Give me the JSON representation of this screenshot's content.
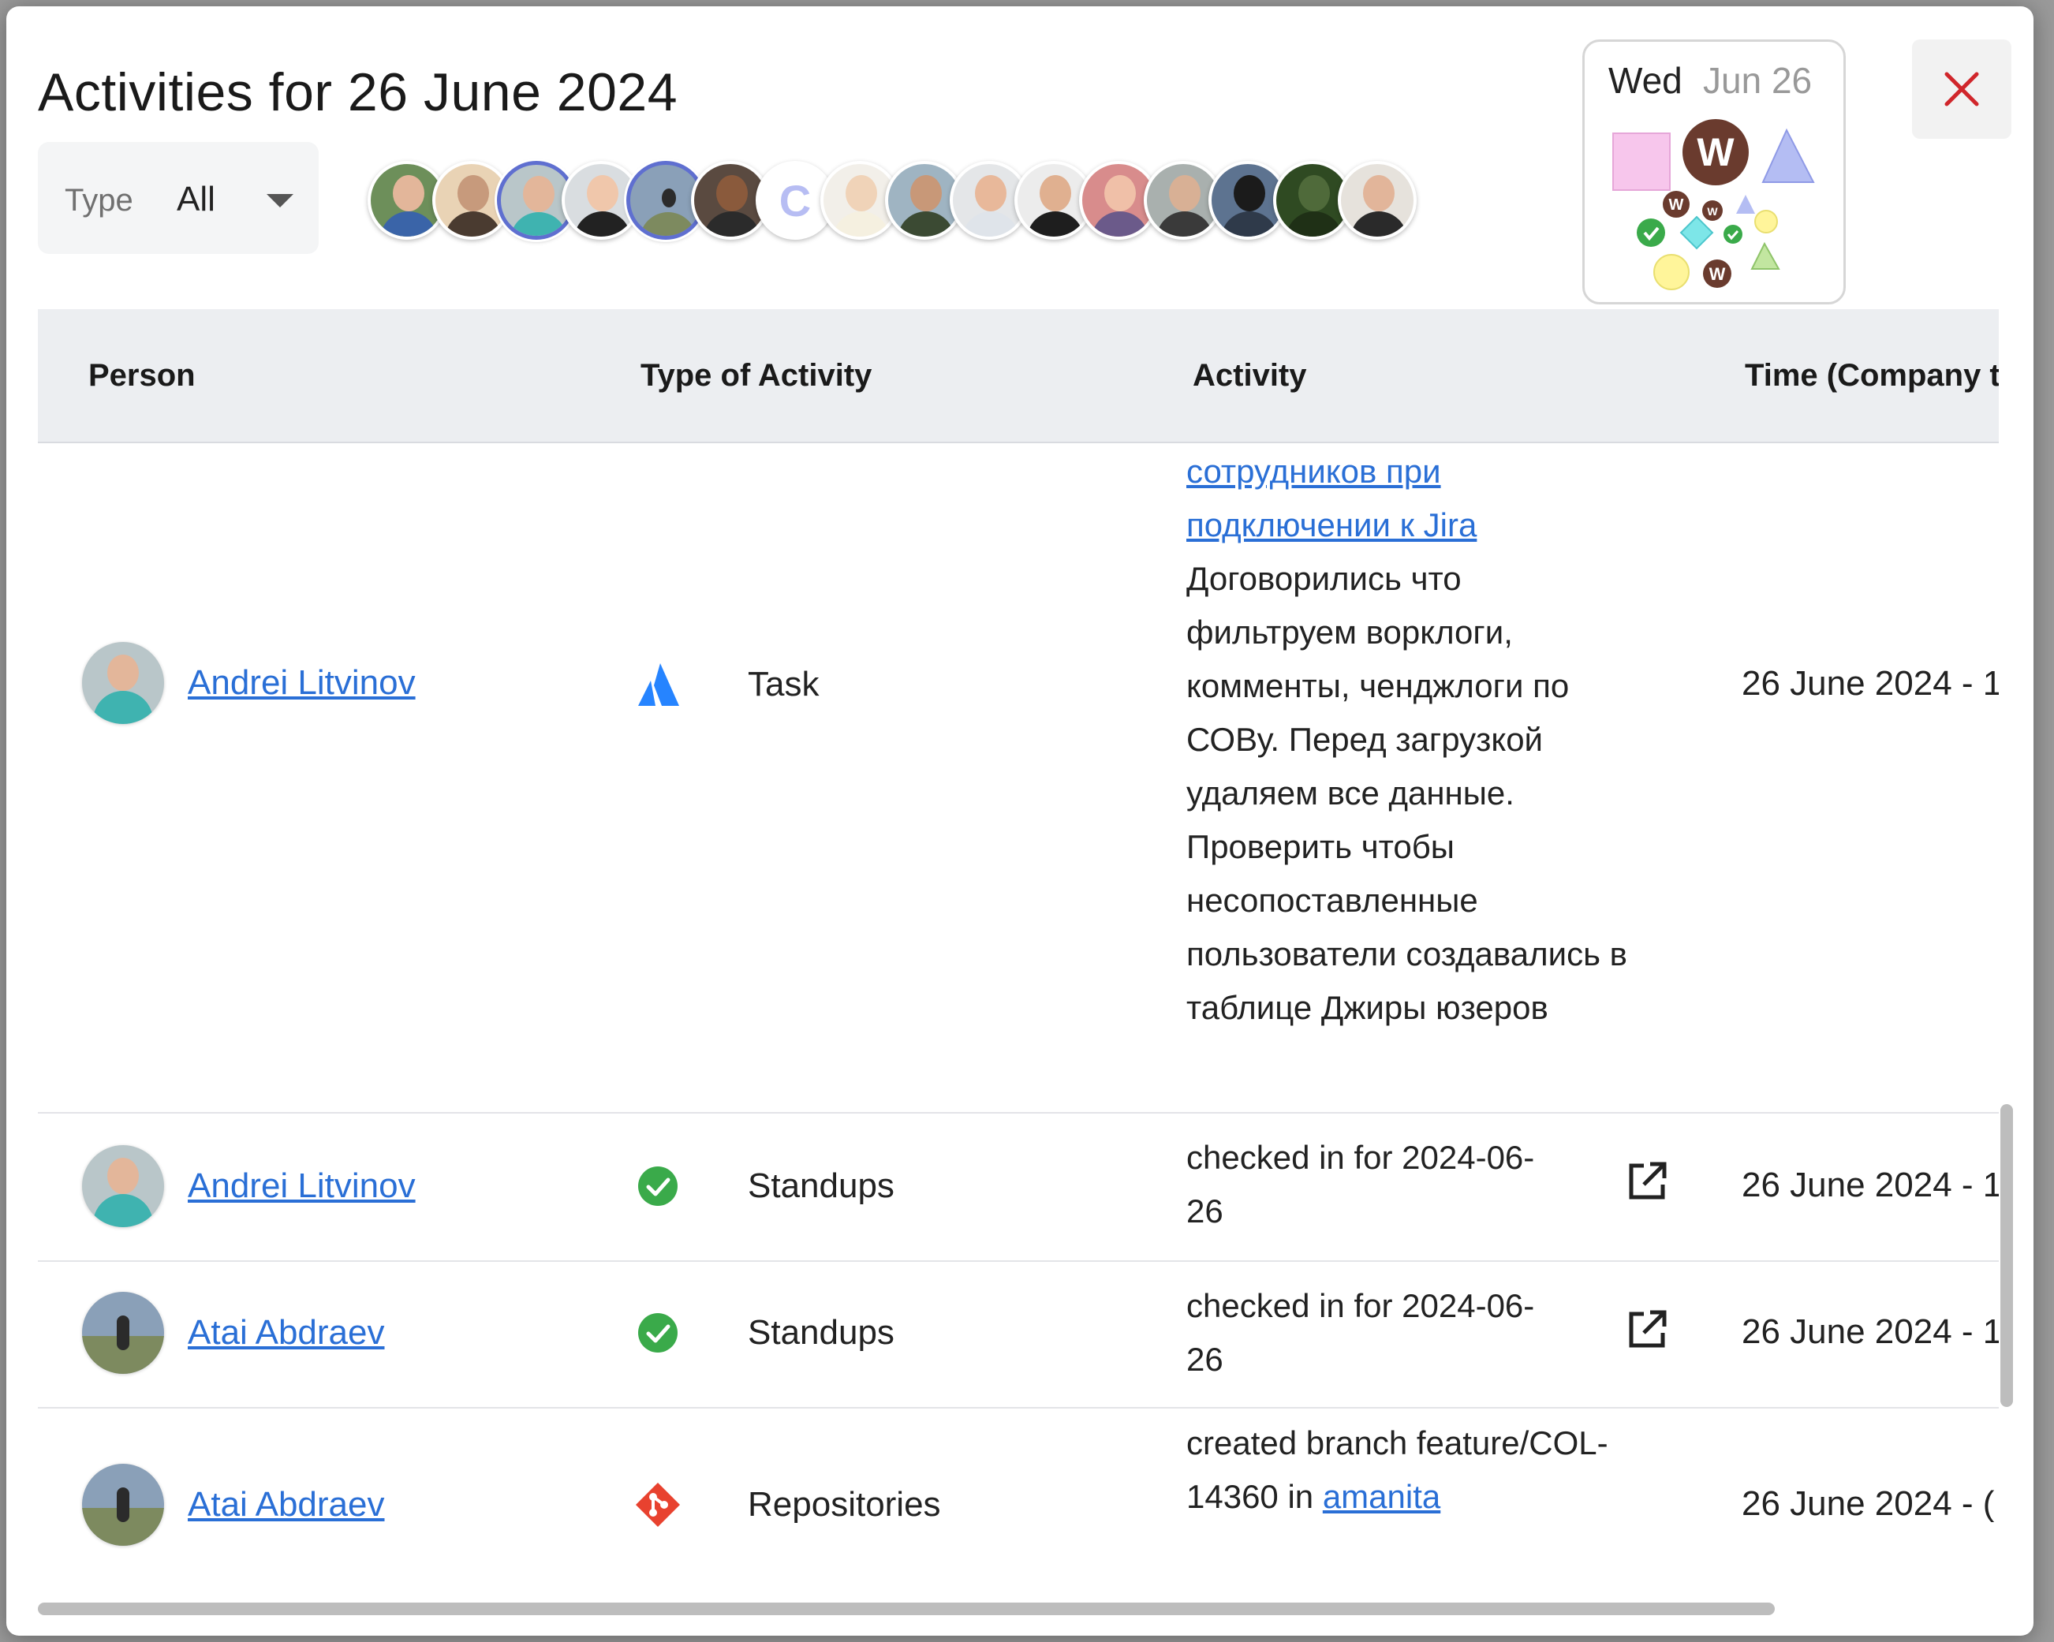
{
  "header": {
    "title": "Activities for 26 June 2024",
    "close_icon": "close-icon"
  },
  "filter": {
    "type_label": "Type",
    "type_value": "All"
  },
  "avatar_letter": "C",
  "date_card": {
    "day": "Wed",
    "date": "Jun 26",
    "marker_letter": "W"
  },
  "table": {
    "columns": [
      "Person",
      "Type of Activity",
      "Activity",
      "Time (Company t"
    ],
    "rows": [
      {
        "person": "Andrei Litvinov",
        "type": "Task",
        "type_icon": "jira-icon",
        "activity_link_lines": [
          "сотрудников при",
          "подключении к Jira"
        ],
        "activity_lines": [
          "Договорились что",
          "фильтруем ворклоги,",
          "комменты, ченджлоги по",
          "СОВу. Перед загрузкой",
          "удаляем все данные.",
          "Проверить чтобы",
          "несопоставленные",
          "пользователи создавались в",
          "таблице Джиры юзеров"
        ],
        "time": "26 June 2024 - 1"
      },
      {
        "person": "Andrei Litvinov",
        "type": "Standups",
        "type_icon": "check-circle-icon",
        "activity_lines": [
          "checked in for 2024-06-",
          "26"
        ],
        "time": "26 June 2024 - 1"
      },
      {
        "person": "Atai Abdraev",
        "type": "Standups",
        "type_icon": "check-circle-icon",
        "activity_lines": [
          "checked in for 2024-06-",
          "26"
        ],
        "time": "26 June 2024 - 1"
      },
      {
        "person": "Atai Abdraev",
        "type": "Repositories",
        "type_icon": "git-icon",
        "activity_lines": [
          "created branch feature/COL-",
          "14360 in "
        ],
        "activity_link": "amanita",
        "time": "26 June 2024 - ("
      }
    ]
  },
  "colors": {
    "link": "#2a6fd6",
    "accent_selected": "#5f6fd0",
    "close": "#d0262b",
    "standup_check": "#3aaa4a",
    "git": "#e8422f",
    "jira": "#2684ff"
  }
}
